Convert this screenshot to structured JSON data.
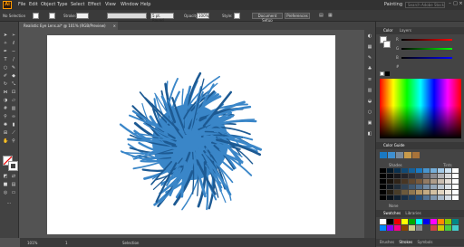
{
  "app": {
    "logo": "Ai"
  },
  "menu": [
    "File",
    "Edit",
    "Object",
    "Type",
    "Select",
    "Effect",
    "View",
    "Window",
    "Help"
  ],
  "workspace": "Painting",
  "search_placeholder": "Search Adobe Stock",
  "control_bar": {
    "selection": "No Selection",
    "stroke_label": "Stroke:",
    "brush": "5 pt. Round",
    "opacity_label": "Opacity:",
    "opacity": "100%",
    "style_label": "Style:",
    "doc_setup": "Document Setup",
    "preferences": "Preferences"
  },
  "document_tab": {
    "title": "Realistic Eye Lens.ai* @ 101% (RGB/Preview)",
    "close": "×"
  },
  "status": {
    "zoom": "101%",
    "page": "1",
    "tool": "Selection"
  },
  "panels": {
    "color": {
      "tabs": [
        "Color",
        "Layers"
      ],
      "sliders": [
        "R",
        "G",
        "B"
      ],
      "hex_prefix": "#"
    },
    "color_guide": {
      "title": "Color Guide",
      "labels": [
        "Shades",
        "Tints"
      ],
      "none_label": "None"
    },
    "swatches": {
      "tabs": [
        "Swatches",
        "Libraries"
      ]
    },
    "bottom_tabs": [
      "Brushes",
      "Strokes",
      "Symbols"
    ]
  },
  "colors": {
    "accent": "#1a79c2",
    "artwork": "#3a86c8",
    "artwork_dark": "#1d5a93"
  }
}
